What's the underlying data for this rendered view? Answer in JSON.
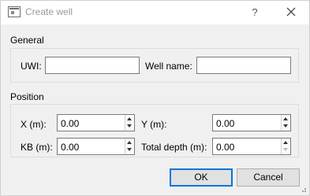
{
  "window": {
    "title": "Create well",
    "help_glyph": "?",
    "icons": {
      "app": "window-icon",
      "close": "close-icon"
    }
  },
  "general": {
    "title": "General",
    "uwi": {
      "label": "UWI:",
      "value": "",
      "placeholder": ""
    },
    "well_name": {
      "label": "Well name:",
      "value": "",
      "placeholder": ""
    }
  },
  "position": {
    "title": "Position",
    "x": {
      "label": "X (m):",
      "value": "0.00"
    },
    "y": {
      "label": "Y (m):",
      "value": "0.00"
    },
    "kb": {
      "label": "KB (m):",
      "value": "0.00"
    },
    "total_depth": {
      "label": "Total depth (m):",
      "value": "0.00"
    }
  },
  "buttons": {
    "ok": "OK",
    "cancel": "Cancel"
  },
  "colors": {
    "background": "#f0f0f0",
    "default_button_border": "#0078d7"
  }
}
